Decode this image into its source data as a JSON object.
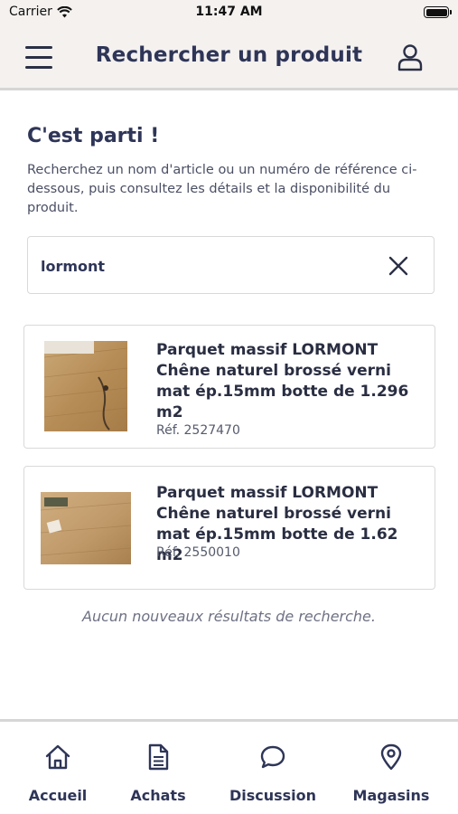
{
  "status_bar": {
    "carrier": "Carrier",
    "time": "11:47 AM"
  },
  "header": {
    "title": "Rechercher un produit",
    "menu_icon": "hamburger-icon",
    "profile_icon": "user-icon"
  },
  "intro": {
    "heading": "C'est parti !",
    "description": "Recherchez un nom d'article ou un numéro de référence ci-dessous, puis consultez les détails et la disponibilité du produit."
  },
  "search": {
    "value": "lormont",
    "clear_icon": "close-icon"
  },
  "results": [
    {
      "name": "Parquet massif LORMONT Chêne naturel brossé verni mat ép.15mm botte de 1.296 m2",
      "reference": "Réf. 2527470"
    },
    {
      "name": "Parquet massif LORMONT Chêne naturel brossé verni mat ép.15mm botte de 1.62 m2",
      "reference": "Réf. 2550010"
    }
  ],
  "no_more_results": "Aucun nouveaux résultats de recherche.",
  "tabs": [
    {
      "label": "Accueil",
      "icon": "home-icon"
    },
    {
      "label": "Achats",
      "icon": "document-icon"
    },
    {
      "label": "Discussion",
      "icon": "chat-bubble-icon"
    },
    {
      "label": "Magasins",
      "icon": "location-pin-icon"
    }
  ],
  "colors": {
    "header_bg": "#f4f1ef",
    "primary_text": "#2e3557",
    "border": "#d9d9d9"
  }
}
